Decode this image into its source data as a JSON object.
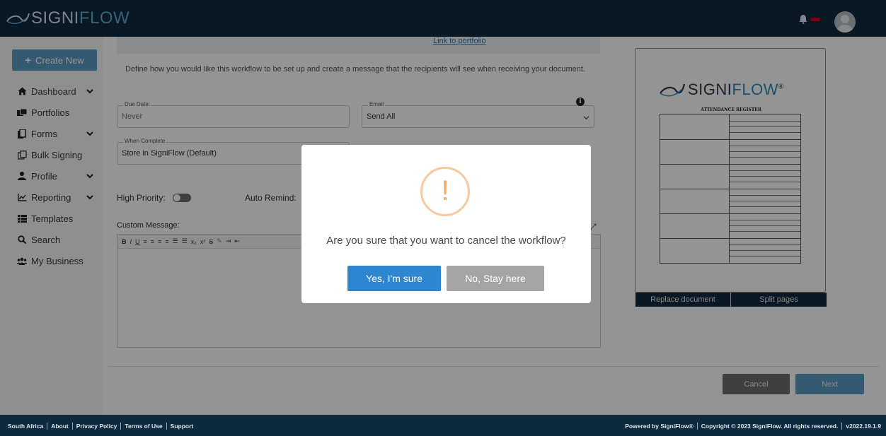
{
  "header": {
    "logo_text_a": "SIGNI",
    "logo_text_b": "FLOW",
    "icons": [
      "bell-icon",
      "avatar"
    ]
  },
  "sidebar": {
    "create_label": "Create New",
    "items": [
      {
        "label": "Dashboard",
        "icon": "home-icon",
        "has_chevron": true
      },
      {
        "label": "Portfolios",
        "icon": "portfolio-icon",
        "has_chevron": false
      },
      {
        "label": "Forms",
        "icon": "forms-icon",
        "has_chevron": true
      },
      {
        "label": "Bulk Signing",
        "icon": "bulk-signing-icon",
        "has_chevron": false
      },
      {
        "label": "Profile",
        "icon": "user-icon",
        "has_chevron": true
      },
      {
        "label": "Reporting",
        "icon": "chart-icon",
        "has_chevron": true
      },
      {
        "label": "Templates",
        "icon": "list-icon",
        "has_chevron": false
      },
      {
        "label": "Search",
        "icon": "search-icon",
        "has_chevron": false
      },
      {
        "label": "My Business",
        "icon": "users-icon",
        "has_chevron": false
      }
    ]
  },
  "main": {
    "link_text": "Link to portfolio",
    "intro": "Define how you would like this workflow to be set up and create a message that the recipients will see when receiving your document.",
    "due_date": {
      "label": "Due Date:",
      "value": "Never"
    },
    "email": {
      "label": "Email",
      "value": "Send All"
    },
    "when_complete": {
      "label": "When Complete",
      "value": "Store in SigniFlow (Default)"
    },
    "high_priority_label": "High Priority:",
    "auto_remind_label": "Auto Remind:",
    "custom_message_label": "Custom Message:",
    "cancel_label": "Cancel",
    "next_label": "Next"
  },
  "preview": {
    "logo_a": "SIGNI",
    "logo_b": "FLOW",
    "logo_mark": "®",
    "subtitle": "ATTENDANCE REGISTER",
    "replace_label": "Replace document",
    "split_label": "Split pages"
  },
  "modal": {
    "icon": "!",
    "message": "Are you sure that you want to cancel the workflow?",
    "yes_label": "Yes, I'm sure",
    "no_label": "No, Stay here"
  },
  "footer": {
    "left": [
      "South Africa",
      "About",
      "Privacy Policy",
      "Terms of Use",
      "Support"
    ],
    "right": [
      "Powered by SigniFlow®",
      "Copyright © 2023 SigniFlow. All rights reserved.",
      "v2022.19.1.9"
    ]
  },
  "colors": {
    "header_bg": "#0e2a3f",
    "accent_blue": "#5b9bc4",
    "modal_primary": "#2f86d0",
    "warning": "#f4a968"
  }
}
